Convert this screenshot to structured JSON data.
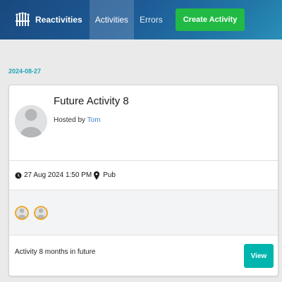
{
  "nav": {
    "brand": "Reactivities",
    "items": [
      {
        "label": "Activities",
        "active": true
      },
      {
        "label": "Errors",
        "active": false
      }
    ],
    "create_label": "Create Activity"
  },
  "group": {
    "date": "2024-08-27"
  },
  "activity": {
    "title": "Future Activity 8",
    "hosted_prefix": "Hosted by",
    "host": "Tom",
    "datetime": "27 Aug 2024 1:50 PM",
    "venue": "Pub",
    "description": "Activity 8 months in future",
    "view_label": "View",
    "attendee_count": 2
  },
  "colors": {
    "nav_gradient_start": "#18497d",
    "nav_gradient_end": "#2a8fb8",
    "create_button": "#21ba45",
    "view_button": "#00b5ad",
    "date_header": "#1ea4b8",
    "host_link": "#4183c4",
    "attendee_border": "#f2a11f"
  },
  "icons": {
    "brand": "logo-icon",
    "clock": "clock-icon",
    "marker": "map-marker-icon",
    "avatar": "user-avatar-icon"
  }
}
